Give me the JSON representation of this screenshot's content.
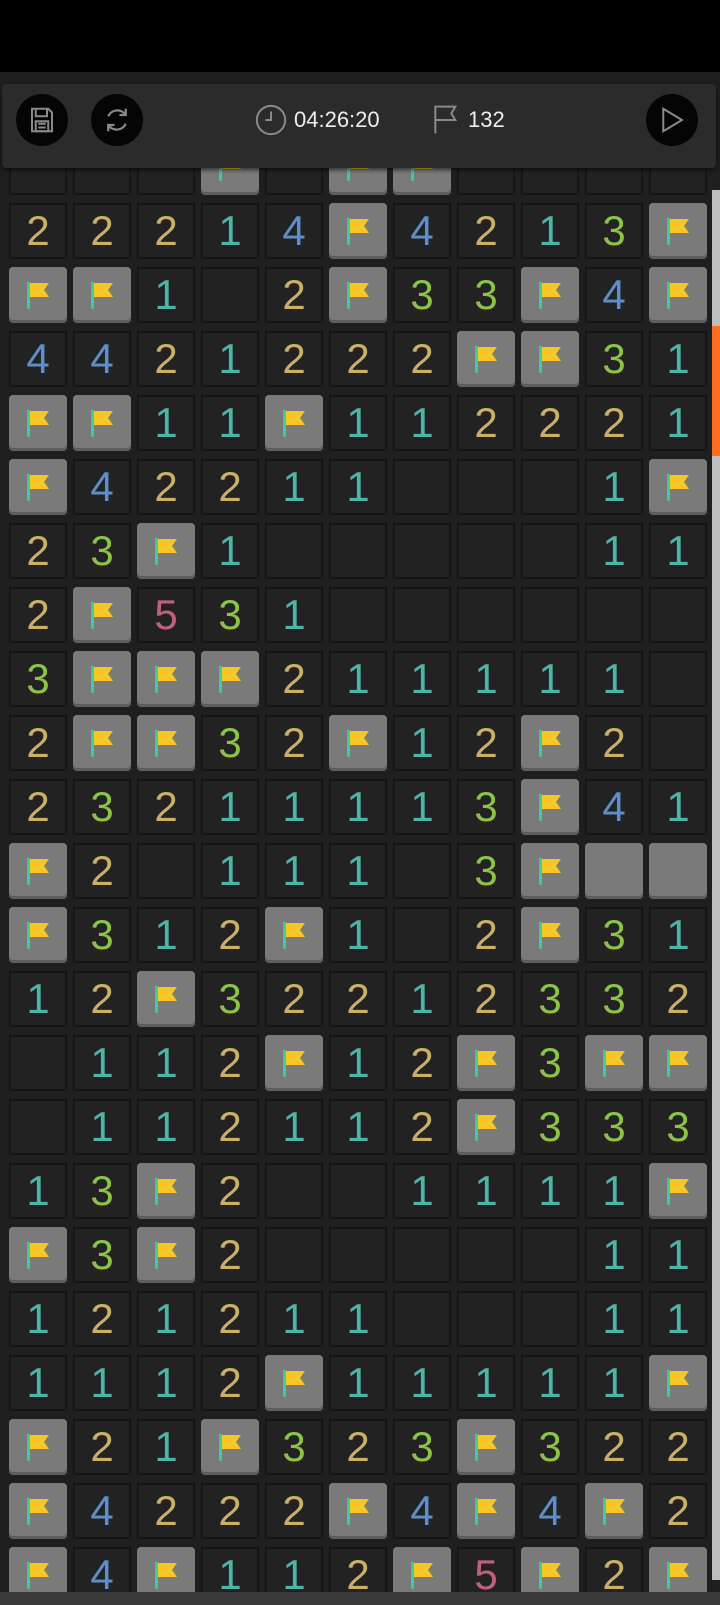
{
  "toolbar": {
    "timer": "04:26:20",
    "flag_count": "132",
    "icons": {
      "save": "save-icon",
      "restart": "refresh-icon",
      "timer": "clock-icon",
      "flags": "flag-icon",
      "play": "play-icon"
    }
  },
  "colors": {
    "accent": "#ff6d1f",
    "flag_yellow": "#f9c623",
    "flag_pole": "#3ec9a7",
    "n1": "#4db6ac",
    "n2": "#c9b06a",
    "n3": "#8bc34a",
    "n4": "#5b8fc9",
    "n5": "#c2607a"
  },
  "board": {
    "columns": 11,
    "legend": {
      "F": "flag",
      "C": "covered",
      "E": "empty",
      "P": "partial"
    },
    "rows": [
      [
        "E",
        "E",
        "P",
        "F",
        "P",
        "F",
        "F",
        "P",
        "E",
        "P",
        "P"
      ],
      [
        "2",
        "2",
        "2",
        "1",
        "4",
        "F",
        "4",
        "2",
        "1",
        "3",
        "F"
      ],
      [
        "F",
        "F",
        "1",
        "E",
        "2",
        "F",
        "3",
        "3",
        "F",
        "4",
        "F"
      ],
      [
        "4",
        "4",
        "2",
        "1",
        "2",
        "2",
        "2",
        "F",
        "F",
        "3",
        "1"
      ],
      [
        "F",
        "F",
        "1",
        "1",
        "F",
        "1",
        "1",
        "2",
        "2",
        "2",
        "1"
      ],
      [
        "F",
        "4",
        "2",
        "2",
        "1",
        "1",
        "E",
        "E",
        "E",
        "1",
        "F"
      ],
      [
        "2",
        "3",
        "F",
        "1",
        "E",
        "E",
        "E",
        "E",
        "E",
        "1",
        "1"
      ],
      [
        "2",
        "F",
        "5",
        "3",
        "1",
        "E",
        "E",
        "E",
        "E",
        "E",
        "E"
      ],
      [
        "3",
        "F",
        "F",
        "F",
        "2",
        "1",
        "1",
        "1",
        "1",
        "1",
        "E"
      ],
      [
        "2",
        "F",
        "F",
        "3",
        "2",
        "F",
        "1",
        "2",
        "F",
        "2",
        "E"
      ],
      [
        "2",
        "3",
        "2",
        "1",
        "1",
        "1",
        "1",
        "3",
        "F",
        "4",
        "1"
      ],
      [
        "F",
        "2",
        "E",
        "1",
        "1",
        "1",
        "E",
        "3",
        "F",
        "C",
        "C"
      ],
      [
        "F",
        "3",
        "1",
        "2",
        "F",
        "1",
        "E",
        "2",
        "F",
        "3",
        "1"
      ],
      [
        "1",
        "2",
        "F",
        "3",
        "2",
        "2",
        "1",
        "2",
        "3",
        "3",
        "2"
      ],
      [
        "E",
        "1",
        "1",
        "2",
        "F",
        "1",
        "2",
        "F",
        "3",
        "F",
        "F"
      ],
      [
        "E",
        "1",
        "1",
        "2",
        "1",
        "1",
        "2",
        "F",
        "3",
        "3",
        "3"
      ],
      [
        "1",
        "3",
        "F",
        "2",
        "E",
        "E",
        "1",
        "1",
        "1",
        "1",
        "F"
      ],
      [
        "F",
        "3",
        "F",
        "2",
        "E",
        "E",
        "E",
        "E",
        "E",
        "1",
        "1"
      ],
      [
        "1",
        "2",
        "1",
        "2",
        "1",
        "1",
        "E",
        "E",
        "E",
        "1",
        "1"
      ],
      [
        "1",
        "1",
        "1",
        "2",
        "F",
        "1",
        "1",
        "1",
        "1",
        "1",
        "F"
      ],
      [
        "F",
        "2",
        "1",
        "F",
        "3",
        "2",
        "3",
        "F",
        "3",
        "2",
        "2"
      ],
      [
        "F",
        "4",
        "2",
        "2",
        "2",
        "F",
        "4",
        "F",
        "4",
        "F",
        "2"
      ],
      [
        "F",
        "4",
        "F",
        "1",
        "1",
        "2",
        "F",
        "5",
        "F",
        "2",
        "F"
      ]
    ]
  }
}
